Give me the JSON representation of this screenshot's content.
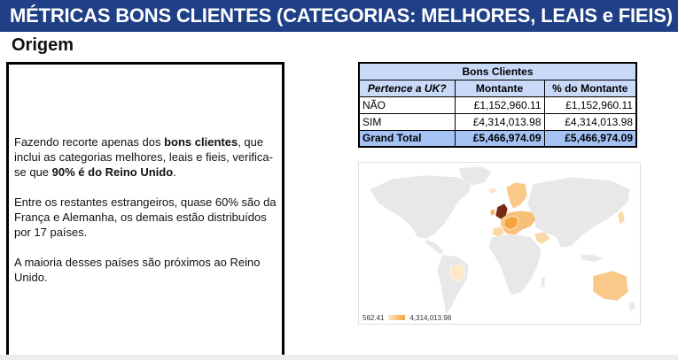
{
  "header": {
    "title": "MÉTRICAS BONS CLIENTES (CATEGORIAS: MELHORES, LEAIS e FIEIS)"
  },
  "section": {
    "title": "Origem"
  },
  "textbox": {
    "p1_a": "Fazendo recorte apenas dos ",
    "p1_b": "bons clientes",
    "p1_c": ", que inclui as categorias melhores, leais e fieis, verifica-se que ",
    "p1_d": "90% é do Reino Unido",
    "p1_e": ".",
    "p2": "Entre os restantes estrangeiros, quase 60% são da França e Alemanha, os demais estão distribuídos por 17 países.",
    "p3": "A maioria desses países são próximos ao Reino Unido."
  },
  "pivot": {
    "title": "Bons Clientes",
    "col_dim": "Pertence a UK?",
    "col_amount": "Montante",
    "col_pct": "% do Montante",
    "rows": [
      {
        "label": "NÃO",
        "amount": "£1,152,960.11",
        "pct": "£1,152,960.11"
      },
      {
        "label": "SIM",
        "amount": "£4,314,013.98",
        "pct": "£4,314,013.98"
      }
    ],
    "total": {
      "label": "Grand Total",
      "amount": "£5,466,974.09",
      "pct": "£5,466,974.09"
    }
  },
  "map": {
    "legend_min": "562.41",
    "legend_max": "4,314,013.98",
    "colors": {
      "land": "#e8e8e8",
      "low": "#fde8c8",
      "mid": "#f3a43c",
      "high": "#7a2a12"
    }
  },
  "colors": {
    "title_bg": "#1f3f86",
    "table_header": "#c9daf8",
    "table_total": "#a4c2f4"
  }
}
